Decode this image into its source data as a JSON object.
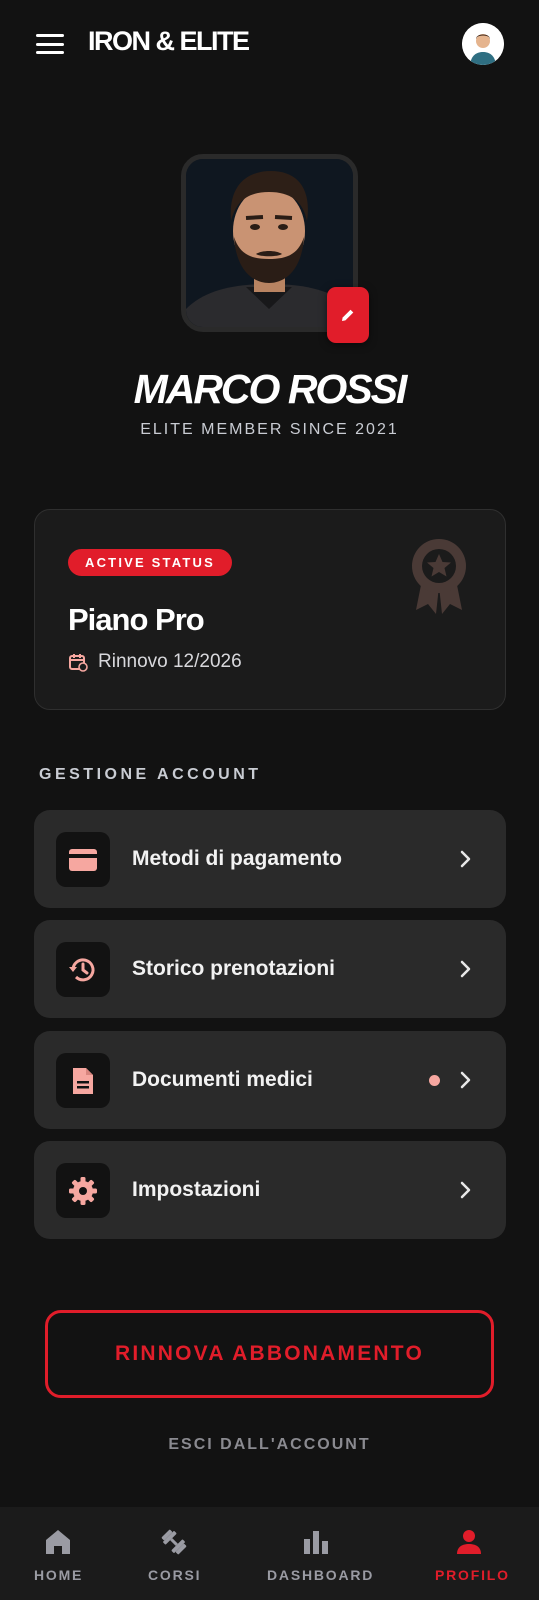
{
  "header": {
    "brand": "IRON & ELITE"
  },
  "profile": {
    "name": "MARCO ROSSI",
    "member_since": "ELITE MEMBER SINCE 2021"
  },
  "plan": {
    "status": "ACTIVE STATUS",
    "name": "Piano Pro",
    "renewal": "Rinnovo 12/2026"
  },
  "account": {
    "section_title": "GESTIONE ACCOUNT",
    "items": [
      {
        "label": "Metodi di pagamento",
        "icon": "credit-card-icon"
      },
      {
        "label": "Storico prenotazioni",
        "icon": "history-icon"
      },
      {
        "label": "Documenti medici",
        "icon": "document-icon",
        "has_notification": true
      },
      {
        "label": "Impostazioni",
        "icon": "gear-icon"
      }
    ]
  },
  "actions": {
    "renew": "RINNOVA ABBONAMENTO",
    "logout": "ESCI DALL'ACCOUNT"
  },
  "nav": {
    "items": [
      {
        "label": "HOME",
        "icon": "home-icon"
      },
      {
        "label": "CORSI",
        "icon": "dumbbell-icon"
      },
      {
        "label": "DASHBOARD",
        "icon": "bar-chart-icon"
      },
      {
        "label": "PROFILO",
        "icon": "user-icon",
        "active": true
      }
    ]
  },
  "colors": {
    "background": "#121212",
    "accent": "#e11d2a",
    "card": "#2a2a2a",
    "icon_tint": "#f6a7a0"
  }
}
